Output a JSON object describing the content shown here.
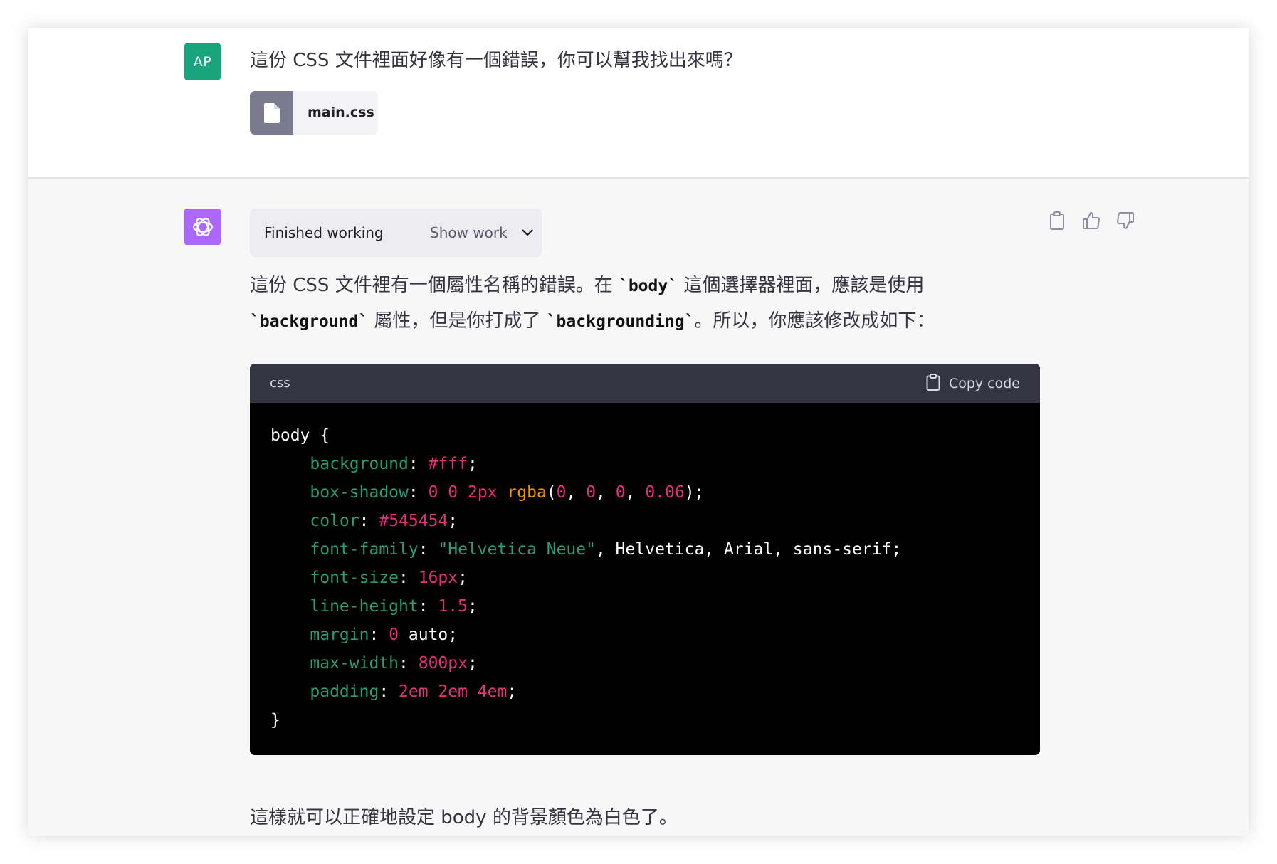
{
  "user": {
    "avatar_initials": "AP",
    "message": "這份 CSS 文件裡面好像有一個錯誤，你可以幫我找出來嗎？",
    "attachment": {
      "file_name": "main.css",
      "icon": "file-icon"
    }
  },
  "assistant": {
    "avatar_icon": "openai-logo-icon",
    "status_text": "Finished working",
    "show_work_label": "Show work",
    "answer_parts": {
      "p1": "這份 CSS 文件裡有一個屬性名稱的錯誤。在 ",
      "c1": "`body`",
      "p2": " 這個選擇器裡面，應該是使用 ",
      "c2": "`background`",
      "p3": " 屬性，但是你打成了 ",
      "c3": "`backgrounding`",
      "p4": "。所以，你應該修改成如下："
    },
    "actions": [
      "clipboard-icon",
      "thumbs-up-icon",
      "thumbs-down-icon"
    ],
    "code_block": {
      "language": "css",
      "copy_label": "Copy code",
      "lines": [
        [
          [
            "plain",
            "body {"
          ]
        ],
        [
          [
            "plain",
            "    "
          ],
          [
            "prop",
            "background"
          ],
          [
            "plain",
            ": "
          ],
          [
            "num",
            "#fff"
          ],
          [
            "plain",
            ";"
          ]
        ],
        [
          [
            "plain",
            "    "
          ],
          [
            "prop",
            "box-shadow"
          ],
          [
            "plain",
            ": "
          ],
          [
            "num",
            "0 0 2px"
          ],
          [
            "plain",
            " "
          ],
          [
            "func",
            "rgba"
          ],
          [
            "plain",
            "("
          ],
          [
            "num",
            "0"
          ],
          [
            "plain",
            ", "
          ],
          [
            "num",
            "0"
          ],
          [
            "plain",
            ", "
          ],
          [
            "num",
            "0"
          ],
          [
            "plain",
            ", "
          ],
          [
            "num",
            "0.06"
          ],
          [
            "plain",
            ");"
          ]
        ],
        [
          [
            "plain",
            "    "
          ],
          [
            "prop",
            "color"
          ],
          [
            "plain",
            ": "
          ],
          [
            "num",
            "#545454"
          ],
          [
            "plain",
            ";"
          ]
        ],
        [
          [
            "plain",
            "    "
          ],
          [
            "prop",
            "font-family"
          ],
          [
            "plain",
            ": "
          ],
          [
            "str",
            "\"Helvetica Neue\""
          ],
          [
            "plain",
            ", Helvetica, Arial, sans-serif;"
          ]
        ],
        [
          [
            "plain",
            "    "
          ],
          [
            "prop",
            "font-size"
          ],
          [
            "plain",
            ": "
          ],
          [
            "num",
            "16px"
          ],
          [
            "plain",
            ";"
          ]
        ],
        [
          [
            "plain",
            "    "
          ],
          [
            "prop",
            "line-height"
          ],
          [
            "plain",
            ": "
          ],
          [
            "num",
            "1.5"
          ],
          [
            "plain",
            ";"
          ]
        ],
        [
          [
            "plain",
            "    "
          ],
          [
            "prop",
            "margin"
          ],
          [
            "plain",
            ": "
          ],
          [
            "num",
            "0"
          ],
          [
            "plain",
            " auto;"
          ]
        ],
        [
          [
            "plain",
            "    "
          ],
          [
            "prop",
            "max-width"
          ],
          [
            "plain",
            ": "
          ],
          [
            "num",
            "800px"
          ],
          [
            "plain",
            ";"
          ]
        ],
        [
          [
            "plain",
            "    "
          ],
          [
            "prop",
            "padding"
          ],
          [
            "plain",
            ": "
          ],
          [
            "num",
            "2em 2em 4em"
          ],
          [
            "plain",
            ";"
          ]
        ],
        [
          [
            "plain",
            "}"
          ]
        ]
      ]
    },
    "closing": "這樣就可以正確地設定 body 的背景顏色為白色了。"
  },
  "colors": {
    "user_avatar": "#19a47e",
    "bot_avatar": "#ab68ff",
    "code_property": "#2e9b75",
    "code_number": "#df3079",
    "code_function": "#e9950c"
  }
}
